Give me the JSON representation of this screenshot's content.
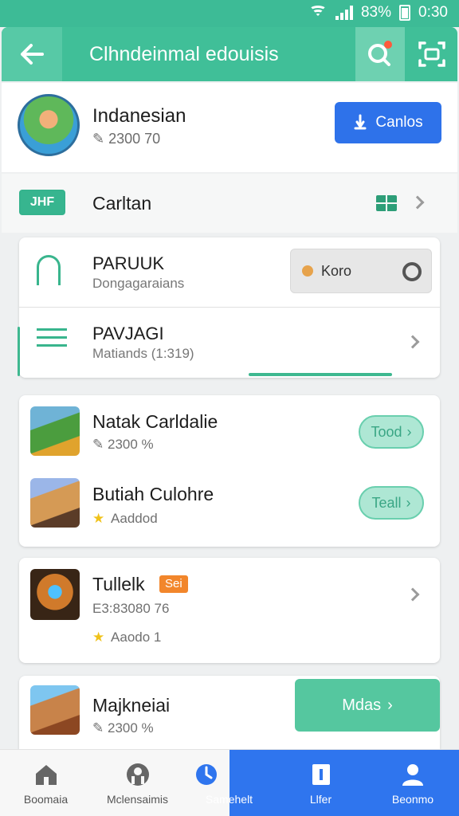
{
  "status": {
    "battery": "83%",
    "time": "0:30"
  },
  "appbar": {
    "title": "Clhndeinmal edouisis"
  },
  "profile": {
    "name": "Indanesian",
    "sub": "2300 70",
    "button_label": "Canlos"
  },
  "section": {
    "badge": "JHF",
    "title": "Carltan"
  },
  "menu": [
    {
      "title": "PARUUK",
      "subtitle": "Dongagaraians",
      "pill_label": "Koro"
    },
    {
      "title": "PAVJAGI",
      "subtitle": "Matiands (1:319)"
    }
  ],
  "games": [
    {
      "title": "Natak Carldalie",
      "sub": "2300 %",
      "button": "Tood"
    },
    {
      "title": "Butiah Culohre",
      "sub": "Aaddod",
      "button": "Teall"
    },
    {
      "title": "Tullelk",
      "tag": "Sei",
      "sub": "E3:83080 76",
      "rating": "Aaodo 1"
    },
    {
      "title": "Majkneiai",
      "sub": "2300 %",
      "button": "Mdas"
    }
  ],
  "nav": [
    {
      "label": "Boomaia"
    },
    {
      "label": "Mclensaimis"
    },
    {
      "label": "Samehelt"
    },
    {
      "label": "Llfer"
    },
    {
      "label": "Beonmo"
    }
  ],
  "colors": {
    "primary": "#40bf98",
    "accent_blue": "#2e72ea"
  }
}
